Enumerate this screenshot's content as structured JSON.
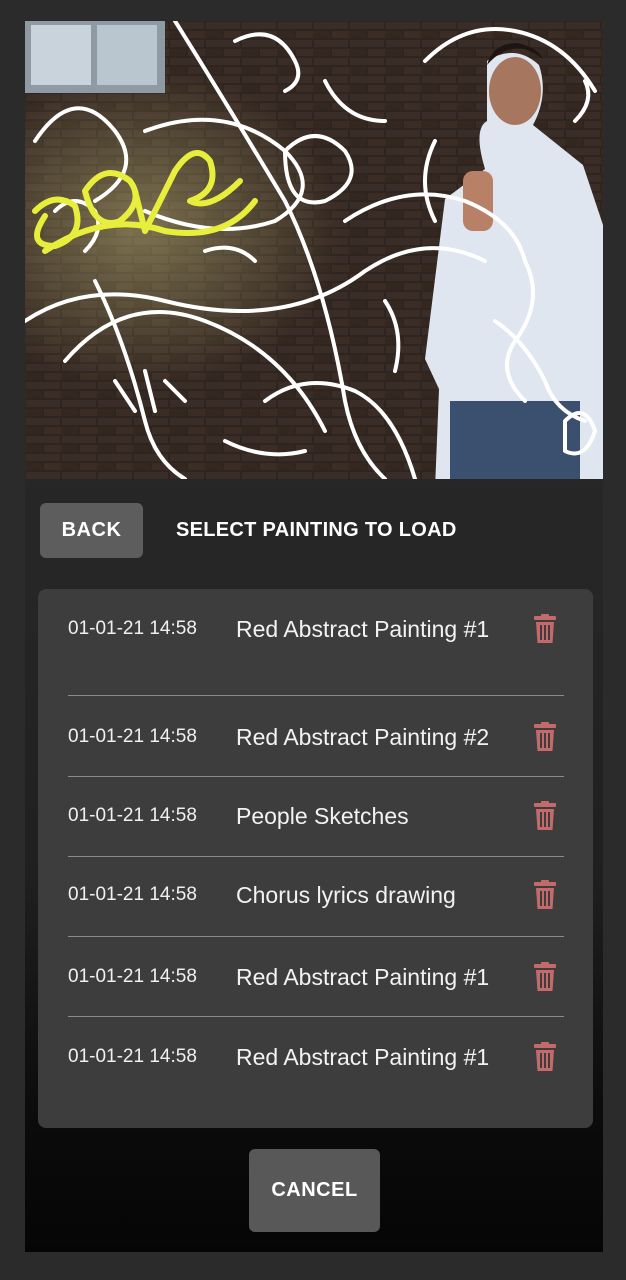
{
  "colors": {
    "background": "#2b2b2b",
    "panel": "#3d3d3d",
    "button": "#5d5d5d",
    "trash_icon": "#c56a6a",
    "sketch_yellow": "#e8ee3c"
  },
  "preview": {
    "icon": "painting-preview-image"
  },
  "header": {
    "back_label": "BACK",
    "title": "SELECT PAINTING TO LOAD"
  },
  "paintings": [
    {
      "timestamp": "01-01-21 14:58",
      "name": "Red Abstract Painting #1",
      "icon": "trash-icon"
    },
    {
      "timestamp": "01-01-21 14:58",
      "name": "Red Abstract Painting #2",
      "icon": "trash-icon"
    },
    {
      "timestamp": "01-01-21 14:58",
      "name": "People Sketches",
      "icon": "trash-icon"
    },
    {
      "timestamp": "01-01-21 14:58",
      "name": "Chorus lyrics drawing",
      "icon": "trash-icon"
    },
    {
      "timestamp": "01-01-21 14:58",
      "name": "Red Abstract Painting #1",
      "icon": "trash-icon"
    },
    {
      "timestamp": "01-01-21 14:58",
      "name": "Red Abstract Painting #1",
      "icon": "trash-icon"
    }
  ],
  "footer": {
    "cancel_label": "CANCEL"
  }
}
